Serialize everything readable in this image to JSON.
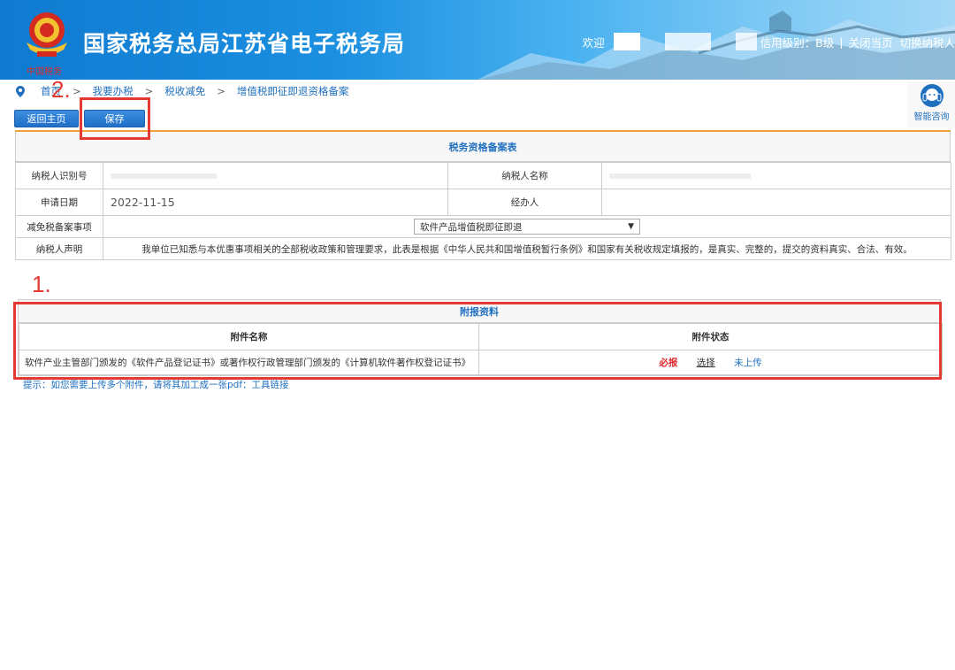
{
  "header": {
    "site_title": "国家税务总局江苏省电子税务局",
    "welcome": "欢迎",
    "credit_rating": "信用级别：B级",
    "separator": "|",
    "close_page": "关闭当页",
    "switch_taxpayer": "切换纳税人"
  },
  "breadcrumb": {
    "items": [
      "首页",
      "我要办税",
      "税收减免",
      "增值税即征即退资格备案"
    ],
    "separator": ">"
  },
  "toolbar": {
    "home_label": "返回主页",
    "save_label": "保存"
  },
  "consult": {
    "label": "智能咨询"
  },
  "annotations": {
    "one": "1.",
    "two": "2."
  },
  "form": {
    "title": "税务资格备案表",
    "taxpayer_id_label": "纳税人识别号",
    "taxpayer_name_label": "纳税人名称",
    "apply_date_label": "申请日期",
    "apply_date_value": "2022-11-15",
    "handler_label": "经办人",
    "filing_item_label": "减免税备案事项",
    "filing_item_value": "软件产品增值税即征即退",
    "declaration_label": "纳税人声明",
    "declaration_text": "我单位已知悉与本优惠事项相关的全部税收政策和管理要求，此表是根据《中华人民共和国增值税暂行条例》和国家有关税收规定填报的，是真实、完整的，提交的资料真实、合法、有效。"
  },
  "attachments": {
    "title": "附报资料",
    "col_name": "附件名称",
    "col_status": "附件状态",
    "rows": [
      {
        "name": "软件产业主管部门颁发的《软件产品登记证书》或著作权行政管理部门颁发的《计算机软件著作权登记证书》",
        "required": "必报",
        "choose": "选择",
        "status": "未上传"
      }
    ],
    "hint": "提示：如您需要上传多个附件，请将其加工成一张pdf：",
    "hint_link": "工具链接"
  },
  "colors": {
    "accent_blue": "#1f6fbf",
    "annotation_red": "#e53a34",
    "required_red": "#e0262b",
    "title_bar_orange": "#f0a23a"
  }
}
